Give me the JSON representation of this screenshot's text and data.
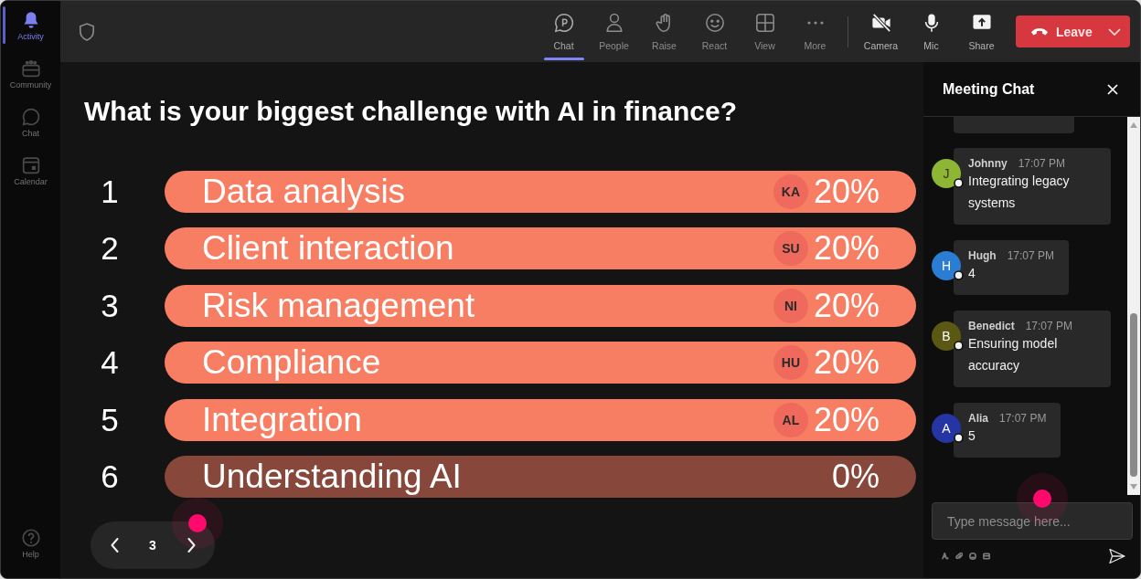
{
  "sidebar": {
    "items": [
      {
        "label": "Activity",
        "selected": true
      },
      {
        "label": "Community",
        "selected": false
      },
      {
        "label": "Chat",
        "selected": false
      },
      {
        "label": "Calendar",
        "selected": false
      }
    ],
    "help": {
      "label": "Help"
    }
  },
  "toolbar": {
    "panels": [
      {
        "label": "Chat",
        "selected": true
      },
      {
        "label": "People",
        "selected": false
      },
      {
        "label": "Raise",
        "selected": false
      },
      {
        "label": "React",
        "selected": false
      },
      {
        "label": "View",
        "selected": false
      },
      {
        "label": "More",
        "selected": false
      }
    ],
    "devices": [
      {
        "label": "Camera",
        "on": false
      },
      {
        "label": "Mic",
        "on": true
      }
    ],
    "share": {
      "label": "Share"
    },
    "leave": {
      "label": "Leave"
    }
  },
  "poll": {
    "question": "What is your biggest challenge with AI in finance?",
    "options": [
      {
        "number": "1",
        "label": "Data analysis",
        "voter": "KA",
        "result": "20%",
        "color": "#f77e62"
      },
      {
        "number": "2",
        "label": "Client interaction",
        "voter": "SU",
        "result": "20%",
        "color": "#f77e62"
      },
      {
        "number": "3",
        "label": "Risk management",
        "voter": "NI",
        "result": "20%",
        "color": "#f77e62"
      },
      {
        "number": "4",
        "label": "Compliance",
        "voter": "HU",
        "result": "20%",
        "color": "#f77e62"
      },
      {
        "number": "5",
        "label": "Integration",
        "voter": "AL",
        "result": "20%",
        "color": "#f77e62"
      },
      {
        "number": "6",
        "label": "Understanding AI",
        "result": "0%",
        "color": "#87473a"
      }
    ],
    "pager": {
      "page": "3"
    }
  },
  "chat": {
    "title": "Meeting Chat",
    "messages": [
      {
        "author": "Johnny",
        "initial": "J",
        "time": "17:07 PM",
        "text": "Integrating legacy systems",
        "color": "#8db634"
      },
      {
        "author": "Hugh",
        "initial": "H",
        "time": "17:07 PM",
        "text": "4",
        "color": "#2b7cd3"
      },
      {
        "author": "Benedict",
        "initial": "B",
        "time": "17:07 PM",
        "text": "Ensuring model accuracy",
        "color": "#5a5812"
      },
      {
        "author": "Alia",
        "initial": "A",
        "time": "17:07 PM",
        "text": "5",
        "color": "#2535a3"
      }
    ],
    "input": {
      "placeholder": "Type message here..."
    }
  }
}
